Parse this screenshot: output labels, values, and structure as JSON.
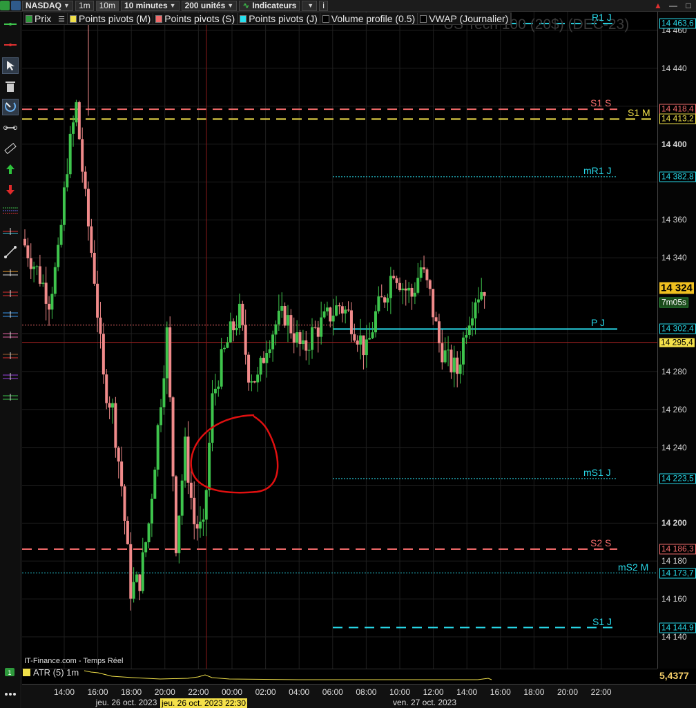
{
  "toolbar": {
    "symbol": "NASDAQ",
    "tf_1m": "1m",
    "tf_10m": "10m",
    "period": "10 minutes",
    "units": "200 unités",
    "indicators": "Indicateurs",
    "info": "i"
  },
  "legend": {
    "items": [
      {
        "label": "Prix",
        "color": "#2e9a3c"
      },
      {
        "label": "Points pivots (M)",
        "color": "#f0e04a"
      },
      {
        "label": "Points pivots (S)",
        "color": "#f06a6a"
      },
      {
        "label": "Points pivots (J)",
        "color": "#28e0ee"
      },
      {
        "label": "Volume profile (0.5)",
        "color": "#000000"
      },
      {
        "label": "VWAP (Journalier)",
        "color": "#000000"
      }
    ],
    "menu_icon": "list-icon"
  },
  "instrument_title": "US Tech 100 (20$) (DEC-23)",
  "price_axis": {
    "ticks": [
      "14 460",
      "14 440",
      "14 400",
      "14 360",
      "14 340",
      "14 280",
      "14 260",
      "14 240",
      "14 200",
      "14 180",
      "14 160",
      "14 140"
    ],
    "levels": [
      {
        "label": "R1 J",
        "value": "14 463,6",
        "color": "#28d8e8"
      },
      {
        "label": "S1 S",
        "value": "14 418,4",
        "color": "#f06a6a"
      },
      {
        "label": "S1 M",
        "value": "14 413,2",
        "color": "#f0e04a"
      },
      {
        "label": "mR1 J",
        "value": "14 382,8",
        "color": "#28d8e8"
      },
      {
        "label": "P J",
        "value": "14 302,4",
        "color": "#28d8e8"
      },
      {
        "label": "mS1 J",
        "value": "14 223,5",
        "color": "#28d8e8"
      },
      {
        "label": "S2 S",
        "value": "14 186,3",
        "color": "#f06a6a"
      },
      {
        "label": "mS2 M",
        "value": "14 173,7",
        "color": "#28d8e8"
      },
      {
        "label": "S1 J",
        "value": "14 144,9",
        "color": "#28d8e8"
      }
    ],
    "last_price": "14 324",
    "countdown": "7m05s",
    "cursor_price": "14 295,4"
  },
  "atr": {
    "label": "ATR (5) 1m",
    "value": "5,4377"
  },
  "source_note": "IT-Finance.com - Temps Réel",
  "time_axis": {
    "ticks": [
      "14:00",
      "16:00",
      "18:00",
      "20:00",
      "22:00",
      "00:00",
      "02:00",
      "04:00",
      "06:00",
      "08:00",
      "10:00",
      "12:00",
      "14:00",
      "16:00",
      "18:00",
      "20:00",
      "22:00"
    ],
    "dates": [
      "jeu. 26 oct. 2023",
      "ven. 27 oct. 2023"
    ],
    "cursor_date": "jeu. 26 oct. 2023 22:30"
  },
  "colors": {
    "up": "#3ec44c",
    "down": "#f08a8a",
    "cyan": "#28d8e8",
    "red": "#f06a6a",
    "yellow": "#f0e04a",
    "annotation": "#e01010"
  },
  "chart_data": {
    "type": "candlestick",
    "x": [
      "13:30",
      "14:00",
      "14:30",
      "15:00",
      "15:30",
      "16:00",
      "16:30",
      "17:00",
      "17:30",
      "18:00",
      "18:30",
      "19:00",
      "19:30",
      "20:00",
      "20:30",
      "21:00",
      "21:30",
      "22:00",
      "22:30",
      "23:00",
      "23:30",
      "00:00",
      "00:30",
      "01:00",
      "01:30",
      "02:00",
      "02:30",
      "03:00",
      "03:30",
      "04:00",
      "04:30",
      "05:00",
      "05:30",
      "06:00",
      "06:30",
      "07:00",
      "07:30",
      "08:00",
      "08:30",
      "09:00",
      "09:30",
      "10:00",
      "10:30",
      "11:00",
      "11:30",
      "12:00",
      "12:30",
      "13:00",
      "13:30",
      "14:00",
      "14:30",
      "15:00"
    ],
    "close": [
      14350,
      14340,
      14330,
      14318,
      14340,
      14390,
      14420,
      14370,
      14330,
      14275,
      14260,
      14220,
      14165,
      14170,
      14200,
      14250,
      14300,
      14190,
      14240,
      14200,
      14195,
      14265,
      14285,
      14300,
      14310,
      14280,
      14275,
      14295,
      14305,
      14310,
      14300,
      14290,
      14300,
      14305,
      14310,
      14315,
      14310,
      14300,
      14290,
      14310,
      14320,
      14335,
      14325,
      14320,
      14335,
      14320,
      14295,
      14285,
      14280,
      14305,
      14320,
      14325
    ],
    "ylim": [
      14135,
      14465
    ],
    "annotation": "red-circle-around-overnight-reversal"
  }
}
